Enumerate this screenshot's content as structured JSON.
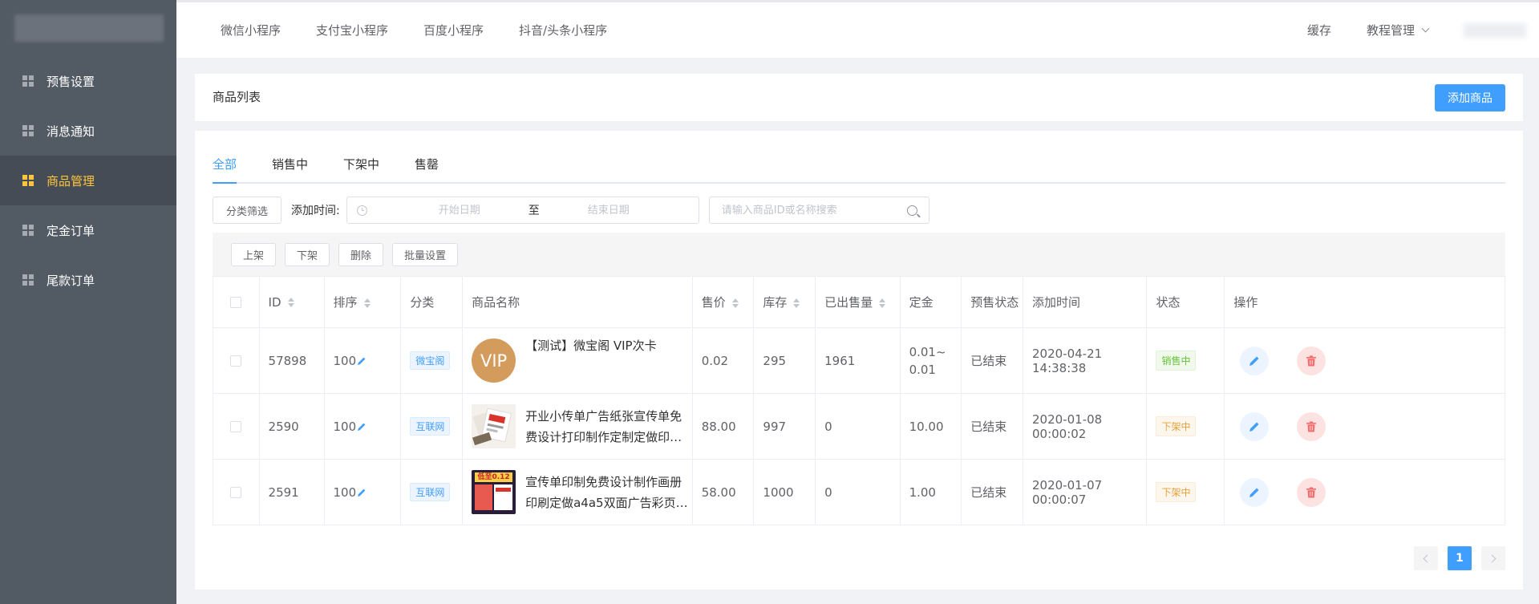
{
  "sidebar": {
    "items": [
      {
        "label": "预售设置",
        "active": false
      },
      {
        "label": "消息通知",
        "active": false
      },
      {
        "label": "商品管理",
        "active": true
      },
      {
        "label": "定金订单",
        "active": false
      },
      {
        "label": "尾款订单",
        "active": false
      }
    ]
  },
  "topbar": {
    "tabs": [
      "微信小程序",
      "支付宝小程序",
      "百度小程序",
      "抖音/头条小程序"
    ],
    "cache_label": "缓存",
    "tutorial_label": "教程管理"
  },
  "header": {
    "title": "商品列表",
    "add_button": "添加商品"
  },
  "status_tabs": [
    "全部",
    "销售中",
    "下架中",
    "售罄"
  ],
  "filters": {
    "category_button": "分类筛选",
    "time_label": "添加时间:",
    "start_placeholder": "开始日期",
    "separator": "至",
    "end_placeholder": "结束日期",
    "search_placeholder": "请输入商品ID或名称搜索"
  },
  "batch": {
    "on_shelf": "上架",
    "off_shelf": "下架",
    "delete": "删除",
    "batch_settings": "批量设置"
  },
  "table": {
    "columns": {
      "id": "ID",
      "sort": "排序",
      "category": "分类",
      "name": "商品名称",
      "price": "售价",
      "stock": "库存",
      "sold": "已出售量",
      "deposit": "定金",
      "presale_status": "预售状态",
      "add_time": "添加时间",
      "status": "状态",
      "ops": "操作"
    },
    "rows": [
      {
        "id": "57898",
        "sort": "100",
        "category": "微宝阁",
        "thumb_text": "VIP",
        "name": "【测试】微宝阁 VIP次卡",
        "price": "0.02",
        "stock": "295",
        "sold": "1961",
        "deposit": "0.01~0.01",
        "presale_status": "已结束",
        "add_time": "2020-04-21 14:38:38",
        "status": "销售中"
      },
      {
        "id": "2590",
        "sort": "100",
        "category": "互联网",
        "name": "开业小传单广告纸张宣传单免费设计打印制作定制定做印刷品单面",
        "price": "88.00",
        "stock": "997",
        "sold": "0",
        "deposit": "10.00",
        "presale_status": "已结束",
        "add_time": "2020-01-08 00:00:02",
        "status": "下架中"
      },
      {
        "id": "2591",
        "sort": "100",
        "category": "互联网",
        "thumb_text": "低至0.12",
        "name": "宣传单印制免费设计制作画册印刷定做a4a5双面广告彩页dm单页...",
        "price": "58.00",
        "stock": "1000",
        "sold": "0",
        "deposit": "1.00",
        "presale_status": "已结束",
        "add_time": "2020-01-07 00:00:07",
        "status": "下架中"
      }
    ]
  },
  "pagination": {
    "current": "1"
  },
  "colors": {
    "primary": "#409eff",
    "sidebar_bg": "#525a64",
    "sidebar_active": "#ffc53d",
    "success": "#67c23a",
    "warning": "#e6a23c",
    "danger": "#f56c6c"
  }
}
